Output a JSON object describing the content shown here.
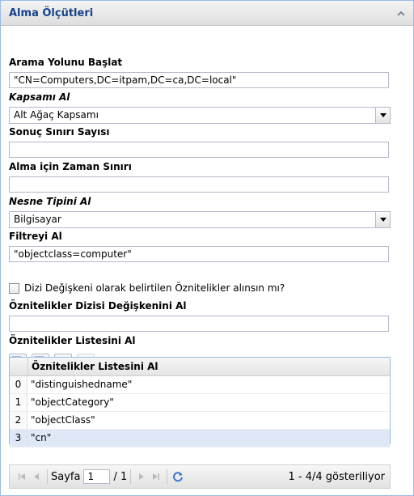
{
  "panel": {
    "title": "Alma Ölçütleri"
  },
  "form": {
    "search_path_label": "Arama Yolunu Başlat",
    "search_path_value": "\"CN=Computers,DC=itpam,DC=ca,DC=local\"",
    "scope_label": "Kapsamı Al",
    "scope_value": "Alt Ağaç Kapsamı",
    "result_limit_label": "Sonuç Sınırı Sayısı",
    "result_limit_value": "",
    "time_limit_label": "Alma için Zaman Sınırı",
    "time_limit_value": "",
    "object_type_label": "Nesne Tipini Al",
    "object_type_value": "Bilgisayar",
    "filter_label": "Filtreyi Al",
    "filter_value": "\"objectclass=computer\"",
    "array_checkbox_label": "Dizi Değişkeni olarak belirtilen Öznitelikler alınsın mı?",
    "array_var_label": "Öznitelikler Dizisi Değişkenini Al",
    "array_var_value": "",
    "attr_list_label": "Öznitelikler Listesini Al"
  },
  "grid": {
    "column_header": "Öznitelikler Listesini Al",
    "rows": [
      {
        "num": "0",
        "value": "\"distinguishedname\""
      },
      {
        "num": "1",
        "value": "\"objectCategory\""
      },
      {
        "num": "2",
        "value": "\"objectClass\""
      },
      {
        "num": "3",
        "value": "\"cn\""
      }
    ]
  },
  "pager": {
    "page_label": "Sayfa",
    "page_value": "1",
    "page_total": "/ 1",
    "display_info": "1 - 4/4 gösteriliyor"
  },
  "icons": {
    "add_row": "add-row-icon",
    "delete_row": "delete-row-icon",
    "move_up": "arrow-up-icon",
    "move_down": "arrow-down-icon",
    "refresh": "refresh-icon"
  },
  "colors": {
    "title": "#15428b",
    "selected_row": "#dfe8f6",
    "border_accent": "#99bbe8"
  }
}
